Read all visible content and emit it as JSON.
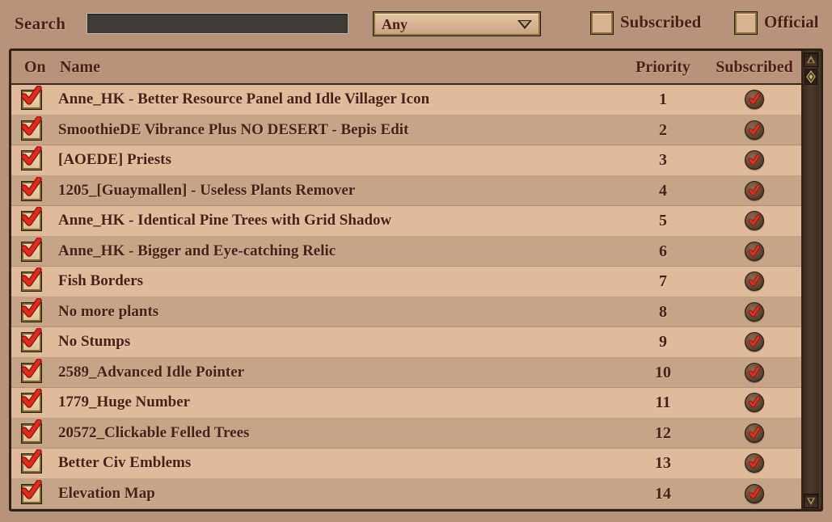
{
  "toolbar": {
    "search_label": "Search",
    "search_value": "",
    "search_placeholder": "",
    "filter_selected": "Any",
    "filter_options": [
      "Any"
    ],
    "subscribed_label": "Subscribed",
    "official_label": "Official",
    "subscribed_checked": false,
    "official_checked": false
  },
  "table": {
    "columns": {
      "on": "On",
      "name": "Name",
      "priority": "Priority",
      "subscribed": "Subscribed"
    },
    "rows": [
      {
        "on": true,
        "name": "Anne_HK - Better Resource Panel and Idle Villager Icon",
        "priority": "1",
        "subscribed": true
      },
      {
        "on": true,
        "name": "SmoothieDE Vibrance Plus NO DESERT - Bepis Edit",
        "priority": "2",
        "subscribed": true
      },
      {
        "on": true,
        "name": "[AOEDE] Priests",
        "priority": "3",
        "subscribed": true
      },
      {
        "on": true,
        "name": "1205_[Guaymallen] - Useless Plants Remover",
        "priority": "4",
        "subscribed": true
      },
      {
        "on": true,
        "name": "Anne_HK - Identical Pine Trees with Grid Shadow",
        "priority": "5",
        "subscribed": true
      },
      {
        "on": true,
        "name": "Anne_HK - Bigger and Eye-catching Relic",
        "priority": "6",
        "subscribed": true
      },
      {
        "on": true,
        "name": "Fish Borders",
        "priority": "7",
        "subscribed": true
      },
      {
        "on": true,
        "name": "No more plants",
        "priority": "8",
        "subscribed": true
      },
      {
        "on": true,
        "name": "No Stumps",
        "priority": "9",
        "subscribed": true
      },
      {
        "on": true,
        "name": "2589_Advanced Idle Pointer",
        "priority": "10",
        "subscribed": true
      },
      {
        "on": true,
        "name": "1779_Huge Number",
        "priority": "11",
        "subscribed": true
      },
      {
        "on": true,
        "name": "20572_Clickable Felled Trees",
        "priority": "12",
        "subscribed": true
      },
      {
        "on": true,
        "name": "Better Civ Emblems",
        "priority": "13",
        "subscribed": true
      },
      {
        "on": true,
        "name": "Elevation Map",
        "priority": "14",
        "subscribed": true
      }
    ]
  },
  "scrollbar": {
    "up_icon": "scroll-up-arrow-icon",
    "down_icon": "scroll-down-arrow-icon",
    "thumb_icon": "scroll-thumb-diamond-icon"
  },
  "colors": {
    "page_background": "#b8927a",
    "row_light": "#dfbb9b",
    "row_dark": "#c5a488",
    "text": "#4a1f1a",
    "gold_border": "#8c7433",
    "dark_border": "#2e2118",
    "check_red": "#d42a20",
    "input_background": "#3f3b36"
  }
}
